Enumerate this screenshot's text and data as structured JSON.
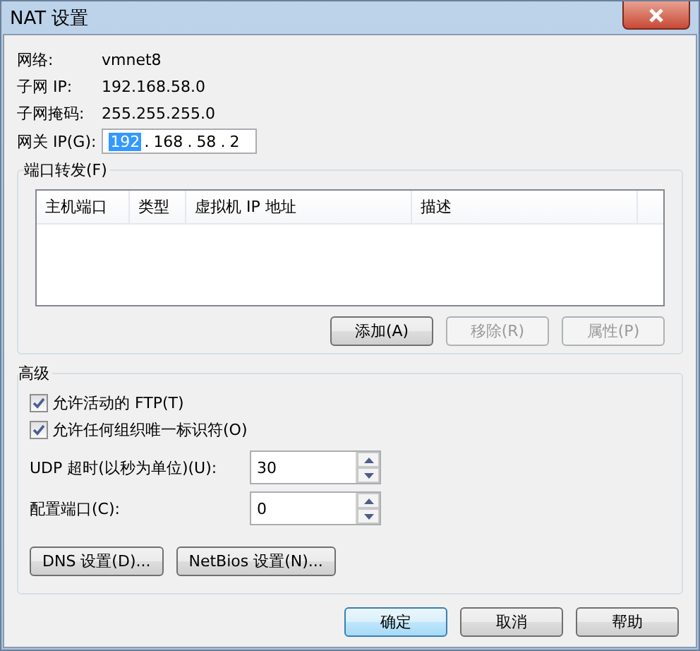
{
  "window": {
    "title": "NAT 设置"
  },
  "info": [
    {
      "label": "网络:",
      "value": "vmnet8"
    },
    {
      "label": "子网 IP:",
      "value": "192.168.58.0"
    },
    {
      "label": "子网掩码:",
      "value": "255.255.255.0"
    }
  ],
  "gateway": {
    "label": "网关 IP(G):",
    "separator": ".",
    "octets": [
      {
        "text": "192",
        "selected": true
      },
      {
        "text": "168",
        "selected": false
      },
      {
        "text": "58",
        "selected": false
      },
      {
        "text": "2",
        "selected": false
      }
    ]
  },
  "port_forwarding": {
    "title": "端口转发(F)",
    "columns": [
      "主机端口",
      "类型",
      "虚拟机 IP 地址",
      "描述"
    ],
    "buttons": [
      {
        "label": "添加(A)",
        "disabled": false
      },
      {
        "label": "移除(R)",
        "disabled": true
      },
      {
        "label": "属性(P)",
        "disabled": true
      }
    ]
  },
  "advanced": {
    "title": "高级",
    "checkboxes": [
      {
        "label": "允许活动的 FTP(T)",
        "checked": true
      },
      {
        "label": "允许任何组织唯一标识符(O)",
        "checked": true
      }
    ],
    "spinners": [
      {
        "label": "UDP 超时(以秒为单位)(U):",
        "value": "30"
      },
      {
        "label": "配置端口(C):",
        "value": "0"
      }
    ],
    "buttons": [
      "DNS 设置(D)...",
      "NetBios 设置(N)..."
    ]
  },
  "footer_buttons": [
    {
      "label": "确定",
      "default": true
    },
    {
      "label": "取消",
      "default": false
    },
    {
      "label": "帮助",
      "default": false
    }
  ]
}
